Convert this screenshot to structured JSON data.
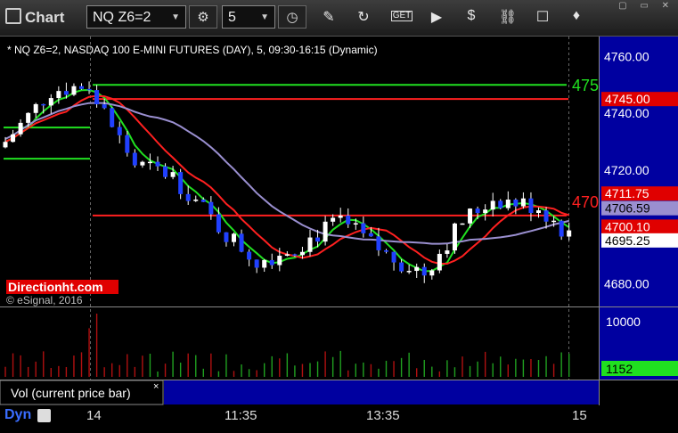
{
  "app": {
    "title": "Chart"
  },
  "toolbar": {
    "symbol": "NQ Z6=2",
    "interval": "5"
  },
  "chart": {
    "header": "* NQ Z6=2, NASDAQ 100 E-MINI FUTURES (DAY), 5, 09:30-16:15 (Dynamic)",
    "watermark_brand": "Directionht.com",
    "copyright": "© eSignal, 2016",
    "price_ticks": [
      "4760.00",
      "4740.00",
      "4720.00",
      "4680.00"
    ],
    "price_tick_values": [
      4760,
      4740,
      4720,
      4680
    ],
    "price_range": [
      4672,
      4767
    ],
    "level_labels": {
      "green_level": "475",
      "red_level": "470"
    },
    "tags": [
      {
        "text": "4745.00",
        "value": 4745.0,
        "bg": "#e00000",
        "fg": "#ffffff"
      },
      {
        "text": "4711.75",
        "value": 4711.75,
        "bg": "#e00000",
        "fg": "#ffffff"
      },
      {
        "text": "4706.59",
        "value": 4706.59,
        "bg": "#9a8fd0",
        "fg": "#000000"
      },
      {
        "text": "4700.10",
        "value": 4700.1,
        "bg": "#e00000",
        "fg": "#ffffff"
      },
      {
        "text": "4695.25",
        "value": 4695.25,
        "bg": "#ffffff",
        "fg": "#000000"
      }
    ],
    "colors": {
      "up": "#ffffff",
      "down": "#2040ff",
      "level_red": "#ff2020",
      "level_green": "#20e020",
      "ma_purple": "#9a8fd0",
      "axis_bg": "#0000a0"
    }
  },
  "volume": {
    "label": "Vol (current price bar)",
    "tick": "10000",
    "tick_value": 10000,
    "current": "1152",
    "current_value": 1152
  },
  "xaxis": {
    "labels": [
      "14",
      "11:35",
      "13:35",
      "15"
    ],
    "footer_label": "Dyn"
  }
}
